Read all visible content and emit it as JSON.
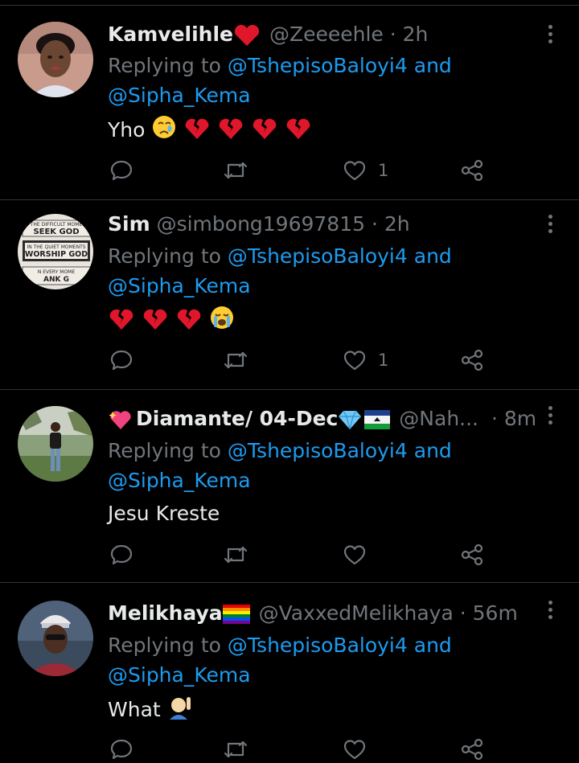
{
  "tweets": [
    {
      "name": "Kamvelihle",
      "handle": "@Zeeeehle",
      "time": "2h",
      "replying_prefix": "Replying to",
      "mention1": "@TshepisoBaloyi4",
      "and": "and",
      "mention2": "@Sipha_Kema",
      "text": "Yho",
      "text_emojis": [
        "crying-face",
        "broken-heart",
        "broken-heart",
        "broken-heart",
        "broken-heart"
      ],
      "like_count": "1"
    },
    {
      "name": "Sim",
      "handle": "@simbong19697815",
      "time": "2h",
      "replying_prefix": "Replying to",
      "mention1": "@TshepisoBaloyi4",
      "and": "and",
      "mention2": "@Sipha_Kema",
      "text": "",
      "text_emojis": [
        "broken-heart",
        "broken-heart",
        "broken-heart",
        "loudly-crying-face"
      ],
      "avatar_signs": [
        "THE DIFFICULT MOME",
        "SEEK GOD",
        "IN THE QUIET MOMENTS",
        "WORSHIP GOD",
        "N EVERY MOME",
        "ANK G"
      ],
      "like_count": "1"
    },
    {
      "name": "Diamante/ 04-Dec",
      "handle": "@Nah...",
      "time": "8m",
      "replying_prefix": "Replying to",
      "mention1": "@TshepisoBaloyi4",
      "and": "and",
      "mention2": "@Sipha_Kema",
      "text": "Jesu Kreste",
      "name_emojis": [
        "sparkling-heart",
        "gem-stone",
        "lesotho-flag"
      ],
      "like_count": ""
    },
    {
      "name": "Melikhaya",
      "handle": "@VaxxedMelikhaya",
      "time": "56m",
      "replying_prefix": "Replying to",
      "mention1": "@TshepisoBaloyi4",
      "and": "and",
      "mention2": "@Sipha_Kema",
      "text": "What",
      "name_emojis": [
        "rainbow-flag"
      ],
      "text_emojis": [
        "person-raising-hand"
      ],
      "like_count": ""
    }
  ],
  "colors": {
    "accent": "#1d9bf0",
    "muted": "#71767b",
    "text": "#e7e9ea",
    "background": "#000000",
    "divider": "#2f3336"
  },
  "time_separator": "·"
}
